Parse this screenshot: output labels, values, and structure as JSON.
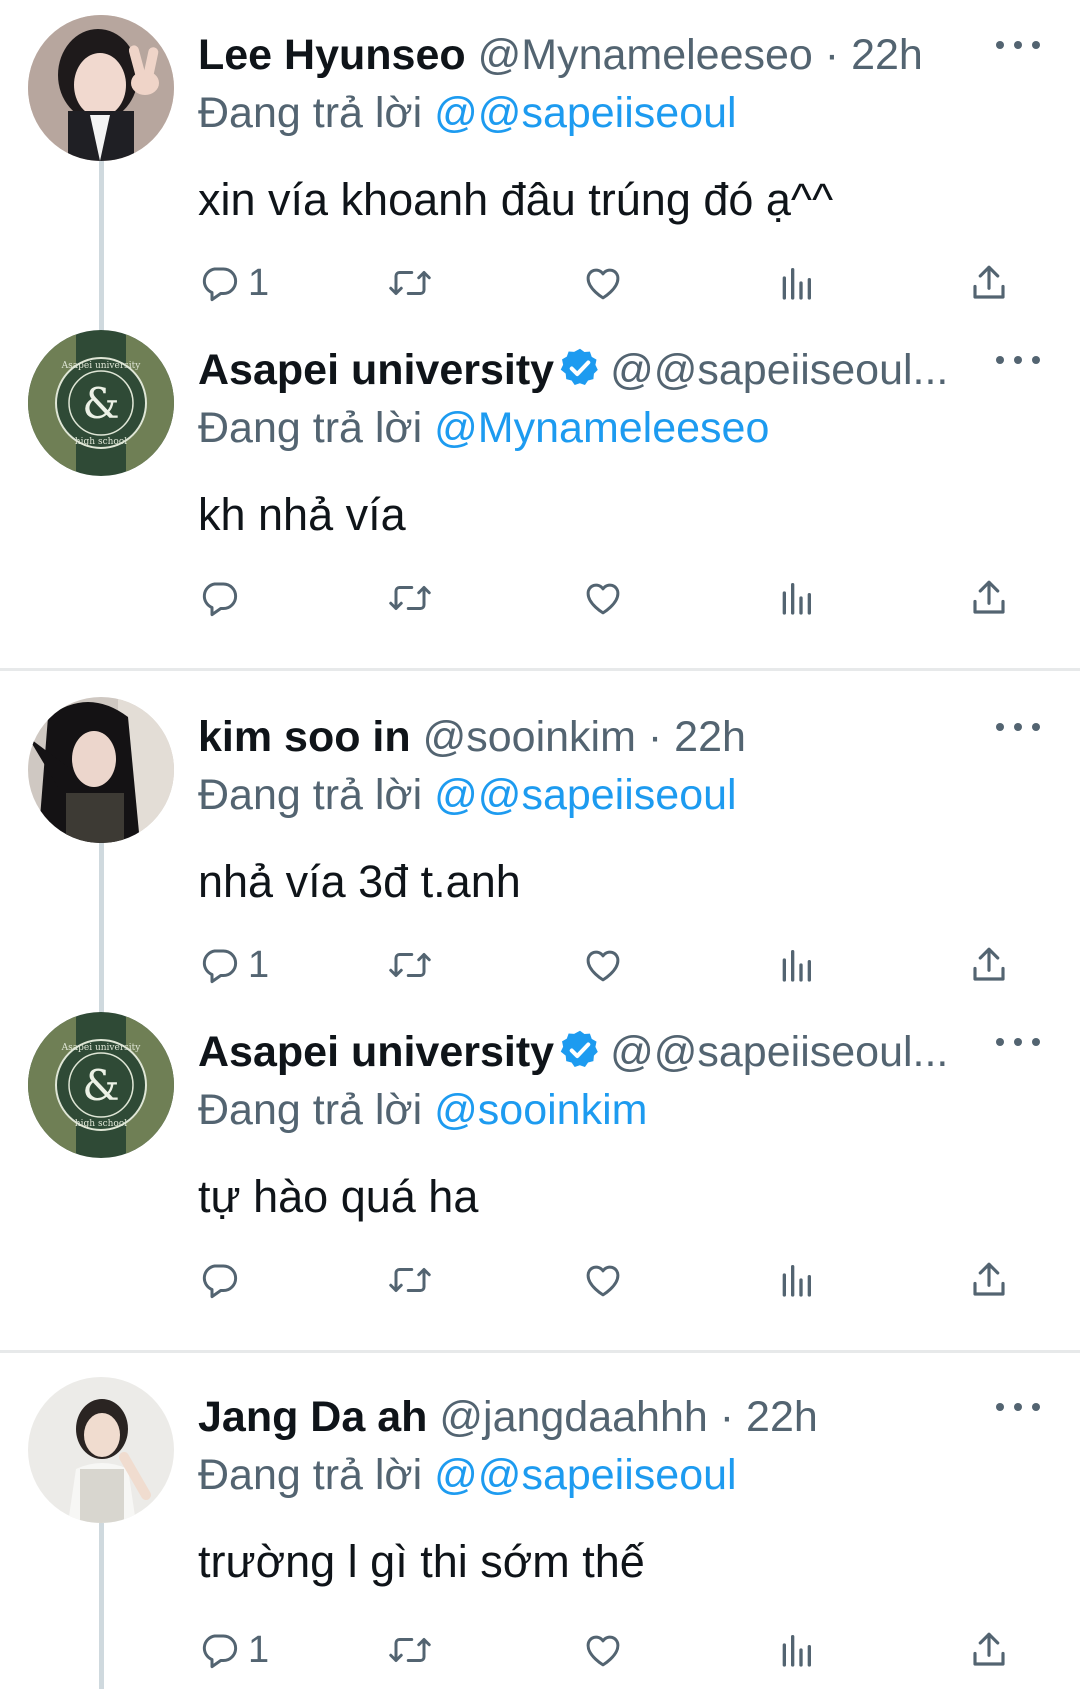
{
  "reply_prefix": "Đang trả lời",
  "tweets": [
    {
      "name": "Lee Hyunseo",
      "handle": "@Mynameleeseo",
      "dot": "·",
      "time": "22h",
      "reply_to": "@@sapeiiseoul",
      "text": "xin vía khoanh đâu trúng đó ạ^^",
      "reply_count": "1",
      "verified": false,
      "avatar": "photo-girl-peace-sign"
    },
    {
      "name": "Asapei university",
      "handle": "@@sapeiiseoul...",
      "reply_to": "@Mynameleeseo",
      "text": "kh nhả vía",
      "verified": true,
      "avatar": "school-logo-ampersand"
    },
    {
      "name": "kim soo in",
      "handle": "@sooinkim",
      "dot": "·",
      "time": "22h",
      "reply_to": "@@sapeiiseoul",
      "text": "nhả vía 3đ t.anh",
      "reply_count": "1",
      "verified": false,
      "avatar": "photo-girl-long-black-hair"
    },
    {
      "name": "Asapei university",
      "handle": "@@sapeiiseoul...",
      "reply_to": "@sooinkim",
      "text": "tự hào quá ha",
      "verified": true,
      "avatar": "school-logo-ampersand"
    },
    {
      "name": "Jang Da ah",
      "handle": "@jangdaahhh",
      "dot": "·",
      "time": "22h",
      "reply_to": "@@sapeiiseoul",
      "text": "trường l gì thi sớm thế",
      "reply_count": "1",
      "verified": false,
      "avatar": "photo-girl-seated"
    }
  ],
  "school_logo": {
    "ring_text_top": "Asapei university",
    "ring_text_bottom": "high school",
    "center": "&"
  },
  "colors": {
    "accent": "#1d9bf0",
    "secondary_text": "#536471",
    "primary_text": "#0f1419",
    "thread_line": "#cfd9de",
    "divider": "#e7e9ea",
    "logo_green_dark": "#2f4a36",
    "logo_green_light": "#6f7f55"
  },
  "icons": [
    "reply-icon",
    "retweet-icon",
    "like-icon",
    "views-icon",
    "share-icon",
    "more-icon",
    "verified-badge-icon"
  ]
}
